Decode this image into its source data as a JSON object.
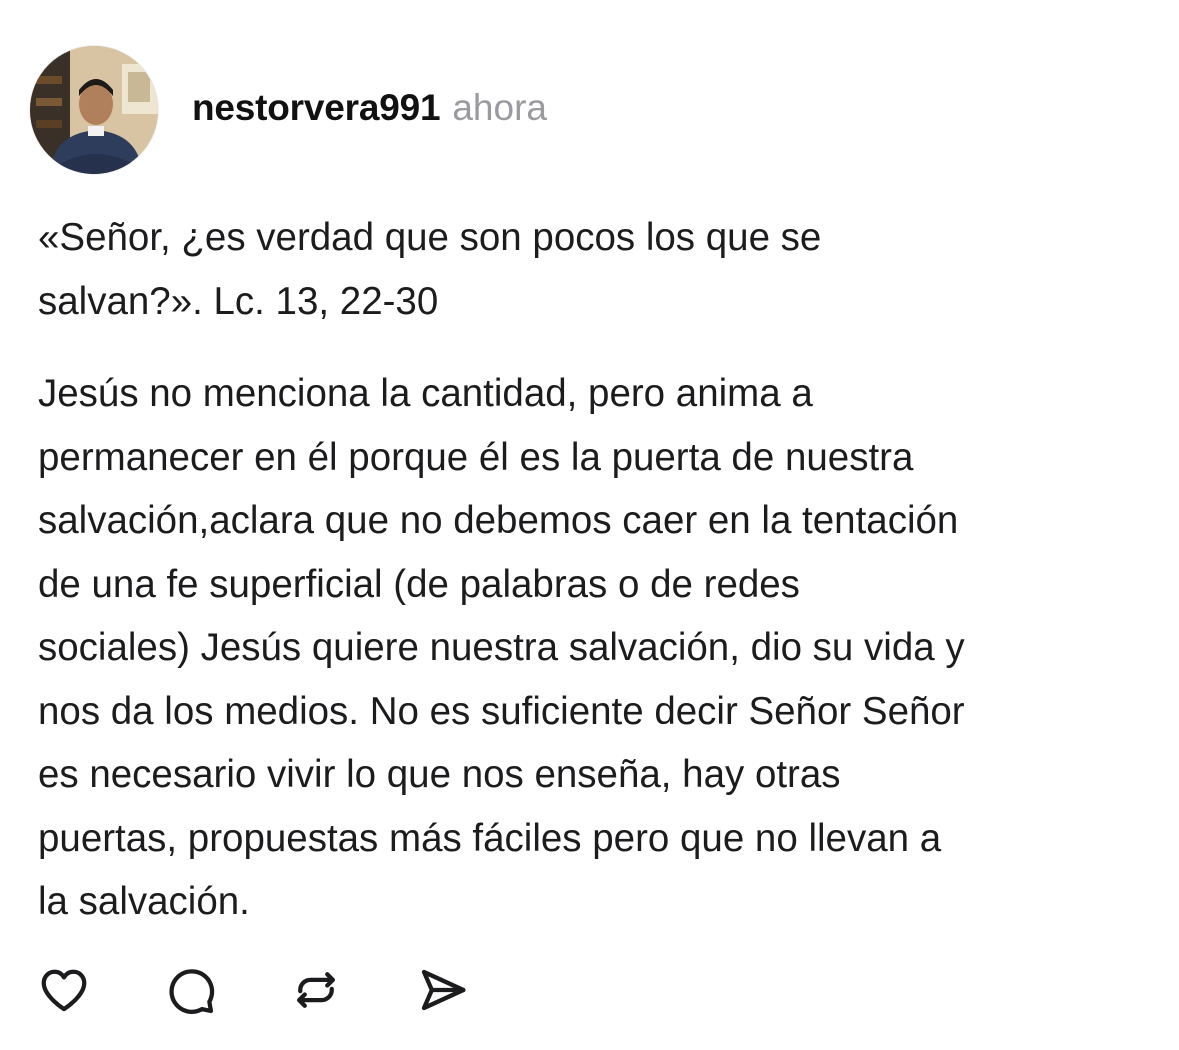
{
  "post": {
    "username": "nestorvera991",
    "time": "ahora",
    "avatar": "profile-photo",
    "paragraphs": [
      "«Señor, ¿es verdad que son pocos los que se\nsalvan?». Lc. 13, 22-30",
      "Jesús no menciona la cantidad, pero anima a\npermanecer en él porque él es la puerta de nuestra\nsalvación,aclara que no debemos caer en la tentación\nde una fe superficial (de palabras o de redes\nsociales) Jesús quiere nuestra salvación, dio su vida y\nnos da los medios. No es suficiente decir Señor Señor\nes necesario vivir lo que nos enseña, hay otras\npuertas, propuestas más fáciles pero que no llevan a\nla salvación."
    ]
  },
  "actions": {
    "icons": [
      "heart-icon",
      "comment-icon",
      "repost-icon",
      "share-icon"
    ]
  },
  "colors": {
    "text": "#1c1c1e",
    "muted": "#9a9a9f",
    "icon": "#1c1c1e"
  }
}
